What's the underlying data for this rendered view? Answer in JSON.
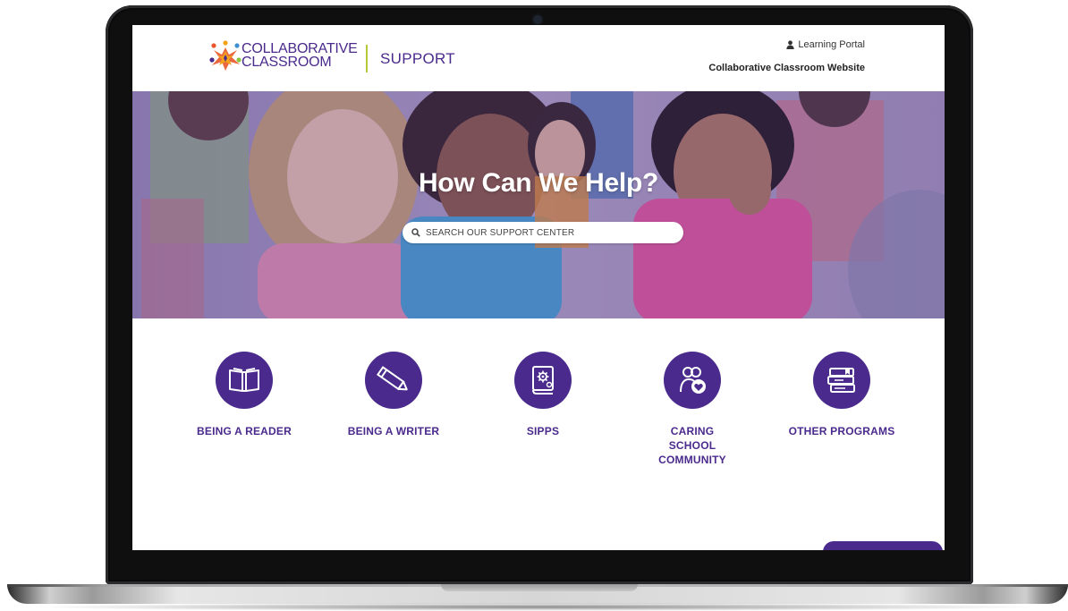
{
  "header": {
    "logo_line1": "COLLABORATIVE",
    "logo_line2": "CLASSROOM",
    "section_label": "SUPPORT",
    "learning_portal_label": "Learning Portal",
    "website_link_label": "Collaborative Classroom Website"
  },
  "hero": {
    "title": "How Can We Help?",
    "search_placeholder": "SEARCH OUR SUPPORT CENTER"
  },
  "categories": [
    {
      "label": "BEING A READER",
      "icon": "book-icon"
    },
    {
      "label": "BEING A WRITER",
      "icon": "pencil-icon"
    },
    {
      "label": "SIPPS",
      "icon": "gear-book-icon"
    },
    {
      "label": "CARING SCHOOL COMMUNITY",
      "icon": "community-heart-icon"
    },
    {
      "label": "OTHER PROGRAMS",
      "icon": "books-stack-icon"
    }
  ],
  "colors": {
    "brand_purple": "#4a2a8c",
    "divider_green": "#b5c93b",
    "hero_tint": "#5c3e96"
  }
}
